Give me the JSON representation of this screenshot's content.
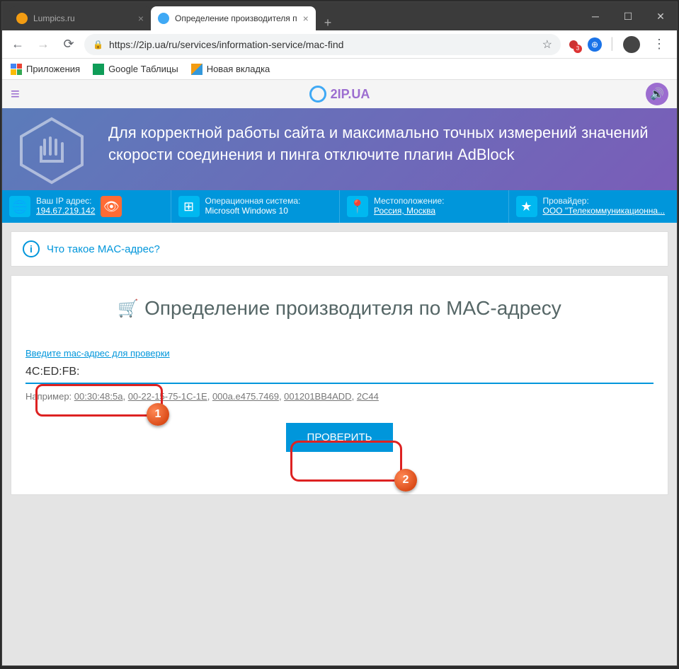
{
  "tabs": [
    {
      "title": "Lumpics.ru",
      "active": false
    },
    {
      "title": "Определение производителя п",
      "active": true
    }
  ],
  "url": "https://2ip.ua/ru/services/information-service/mac-find",
  "bookmarks": {
    "apps": "Приложения",
    "sheets": "Google Таблицы",
    "newtab": "Новая вкладка"
  },
  "logo": "2IP.UA",
  "banner_text": "Для корректной работы сайта и максимально точных измерений значений скорости соединения и пинга отключите плагин AdBlock",
  "infobar": {
    "ip": {
      "label": "Ваш IP адрес:",
      "value": "194.67.219.142"
    },
    "os": {
      "label": "Операционная система:",
      "value": "Microsoft Windows 10"
    },
    "loc": {
      "label": "Местоположение:",
      "value": "Россия, Москва"
    },
    "isp": {
      "label": "Провайдер:",
      "value": "ООО \"Телекоммуникационна..."
    }
  },
  "help_link": "Что такое MAC-адрес?",
  "main_title": "Определение производителя по MAC-адресу",
  "input_label": "Введите mac-адрес для проверки",
  "input_value": "4C:ED:FB:",
  "example_prefix": "Например: ",
  "examples": [
    "00:30:48:5a",
    "00-22-15-75-1C-1E",
    "000a.e475.7469",
    "001201BB4ADD",
    "2C44"
  ],
  "check_button": "ПРОВЕРИТЬ",
  "badges": {
    "b1": "1",
    "b2": "2"
  }
}
